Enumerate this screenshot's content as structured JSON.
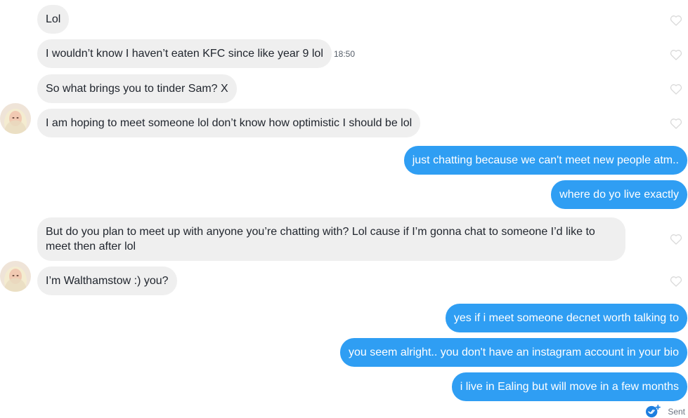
{
  "thread": {
    "incoming_1": "Lol",
    "incoming_2": "I wouldn’t know I haven’t eaten KFC since like year 9 lol",
    "incoming_2_time": "18:50",
    "incoming_3": "So what brings you to tinder Sam? X",
    "incoming_4": "I am hoping to meet someone lol don’t know how optimistic I should be lol",
    "outgoing_1": "just chatting because we can't meet new people atm..",
    "outgoing_2": "where do yo live exactly",
    "incoming_5": "But do you plan to meet up with anyone you’re chatting with? Lol cause if I’m gonna chat to someone I’d like to meet then after lol",
    "incoming_6": "I’m Walthamstow :) you?",
    "outgoing_3": "yes if i meet someone decnet worth talking to",
    "outgoing_4": "you seem alright.. you don't have an instagram account in your bio",
    "outgoing_5": "i live in Ealing but will move in a few months",
    "status": "Sent"
  },
  "icons": {
    "like": "heart-outline-icon",
    "avatar": "match-avatar",
    "sent": "double-check-icon"
  },
  "colors": {
    "incoming_bubble": "#efefef",
    "outgoing_bubble": "#2f9ef3",
    "heart_stroke": "#d9d9d9",
    "sent_icon": "#1d7fe0"
  }
}
